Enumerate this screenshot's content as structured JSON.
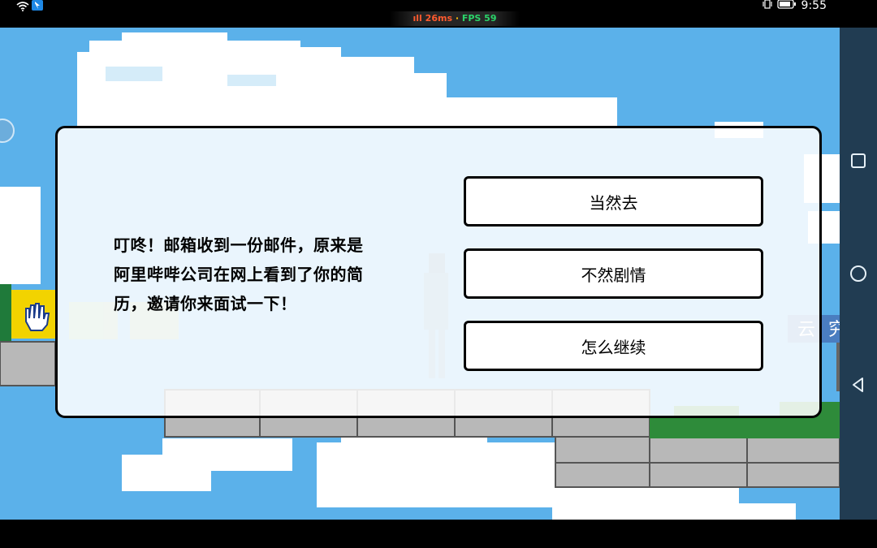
{
  "status_bar": {
    "signal_bars": "ıll",
    "latency": "26ms",
    "separator": " · ",
    "fps": "FPS 59",
    "time": "9:55"
  },
  "dialog": {
    "message_lines": [
      "叮咚！邮箱收到一份邮件，原来是",
      "阿里哔哔公司在网上看到了你的简",
      "历，邀请你来面试一下！"
    ],
    "choices": [
      {
        "label": "当然去"
      },
      {
        "label": "不然剧情"
      },
      {
        "label": "怎么继续"
      }
    ]
  },
  "background": {
    "sign_glyphs": [
      "云",
      "究"
    ],
    "sky_color": "#5bb1ea",
    "cloud_color": "#ffffff",
    "stone_color": "#b8b8b8",
    "bush_color": "#2e8b3a"
  },
  "icons": {
    "wifi": "wifi-icon",
    "notification": "bluetooth-notification-icon",
    "vibrate": "vibrate-icon",
    "battery": "battery-icon",
    "hand": "hand-icon",
    "nav_square": "recent-apps-icon",
    "nav_home": "home-circle-icon",
    "nav_back": "back-triangle-icon"
  }
}
